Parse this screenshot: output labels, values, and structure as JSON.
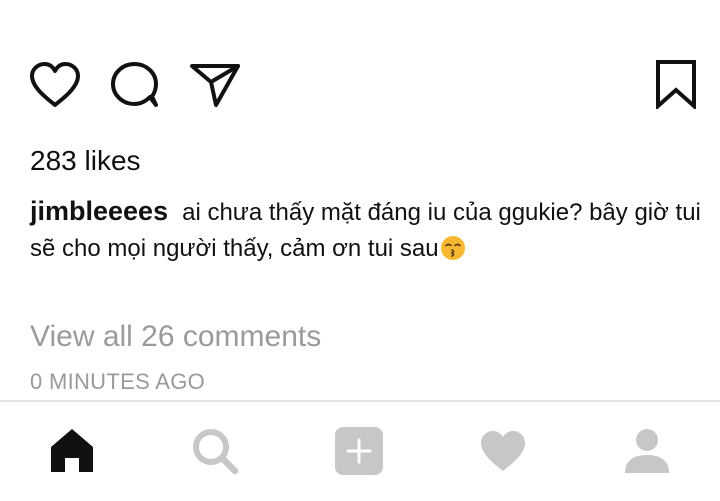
{
  "post": {
    "likes_text": "283 likes",
    "username": "jimbleeees",
    "caption": "ai chưa thấy mặt đáng iu của ggukie? bây giờ tui sẽ cho mọi người thấy, cảm ơn tui sau",
    "view_comments": "View all 26 comments",
    "timestamp": "0 MINUTES AGO"
  },
  "actions": {
    "like_icon": "heart-outline-icon",
    "comment_icon": "comment-bubble-icon",
    "share_icon": "paper-plane-icon",
    "save_icon": "bookmark-outline-icon"
  },
  "tabbar": {
    "items": [
      {
        "name": "home",
        "icon": "home-icon",
        "active": true
      },
      {
        "name": "search",
        "icon": "search-icon",
        "active": false
      },
      {
        "name": "add",
        "icon": "plus-square-icon",
        "active": false
      },
      {
        "name": "activity",
        "icon": "heart-filled-icon",
        "active": false
      },
      {
        "name": "profile",
        "icon": "user-icon",
        "active": false
      }
    ]
  },
  "colors": {
    "text": "#111111",
    "muted": "#9a9a9a",
    "inactive_icon": "#c7c7c7",
    "divider": "#e2e2e2"
  }
}
